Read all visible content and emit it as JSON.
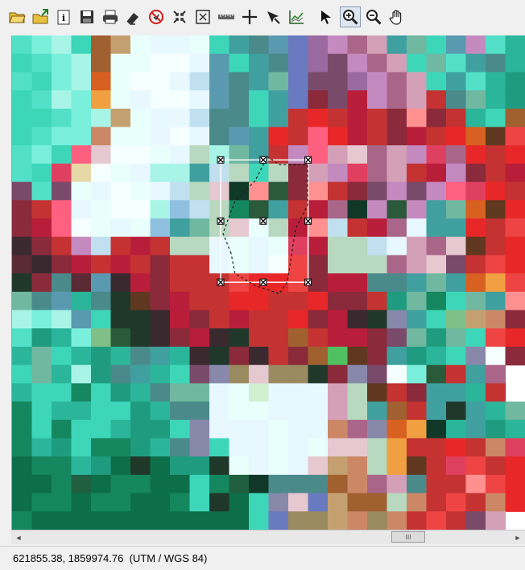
{
  "toolbar": {
    "buttons": [
      {
        "name": "open-folder-icon",
        "active": false
      },
      {
        "name": "export-icon",
        "active": false
      },
      {
        "name": "info-icon",
        "active": false
      },
      {
        "name": "save-icon",
        "active": false
      },
      {
        "name": "print-icon",
        "active": false
      },
      {
        "name": "eraser-icon",
        "active": false
      },
      {
        "name": "clear-selection-icon",
        "active": false
      },
      {
        "name": "shrink-icon",
        "active": false
      },
      {
        "name": "expand-icon",
        "active": false
      },
      {
        "name": "ruler-icon",
        "active": false
      },
      {
        "name": "crosshair-icon",
        "active": false
      },
      {
        "name": "edit-pointer-icon",
        "active": false
      },
      {
        "name": "chart-icon",
        "active": false
      },
      {
        "name": "select-arrow-icon",
        "active": false
      },
      {
        "name": "zoom-in-icon",
        "active": true
      },
      {
        "name": "zoom-out-icon",
        "active": false
      },
      {
        "name": "pan-hand-icon",
        "active": false
      }
    ]
  },
  "map": {
    "palette": {
      "a": "#3dd6b8",
      "b": "#52e0c8",
      "c": "#7af0dc",
      "d": "#a8f5e8",
      "e": "#e8fffb",
      "f": "#f5fffd",
      "g": "#2bb59a",
      "h": "#1f9c80",
      "i": "#15875f",
      "j": "#0d6e4a",
      "k": "#c43232",
      "l": "#e82828",
      "m": "#b81e3a",
      "n": "#8a2a3a",
      "o": "#5a2a35",
      "p": "#3a2a30",
      "q": "#7a4a6a",
      "r": "#9a6aa0",
      "s": "#c48ac0",
      "t": "#d4a0b8",
      "u": "#e6c8d0",
      "v": "#4a8a8a",
      "w": "#5a9ab0",
      "x": "#6a7ac0",
      "y": "#9a8a60",
      "z": "#c4a070",
      "A": "#e8d8a8",
      "B": "#f0a040",
      "C": "#d86020",
      "D": "#a06030",
      "E": "#603820",
      "F": "#20382a",
      "G": "#2a5a3a",
      "H": "#80c088",
      "I": "#b8d8c0",
      "J": "#50c060",
      "K": "#e04060",
      "L": "#ff6080",
      "M": "#ff9090",
      "N": "#c0e0f0",
      "O": "#90c0e0",
      "P": "#40a0a0",
      "Q": "#d0f0d0",
      "R": "#70b8a0",
      "S": "#206040",
      "T": "#103828",
      "U": "#e8f8ff",
      "V": "#8888aa",
      "W": "#aa6688",
      "X": "#cc8866",
      "Y": "#ee4444",
      "Z": "#44cc88"
    },
    "rows": [
      "bcdaDzeUUeaPvwxrsWtPRawsbg",
      "abcdDeeffUwaPvxrqsWtaRbPvg",
      "bacdCeffUNwvPRxqqrsWtaPbgh",
      "abdcBeUffUwvaPxnqmsWtkvRgh",
      "aabcdzeUUNvvaPklkmknMnkgaD",
      "abccXeeUfUvwPlkLlmknmklCEY",
      "bcaLuffeUIdRPksLtuWtsKWlkl",
      "baKAfeUddPNIaIntsKWtkmsnkm",
      "qbqeUfeUNIuTMGnMknqsqsLKlk",
      "nkLUeffdONIiGPkmWTsGsPRCEl",
      "nmLfeUeOPRIueImMNkmWUPPlkY",
      "pnksNkmkIIUeUeKmIINUtWuEkl",
      "opnmkmknkkUeUfYnIIIWtuqkYl",
      "FnvowpmnkkkYllYnmmvvPRPCBY",
      "RvwgvFEnmkkllkklnnkhRiaRPM",
      "dcdwaFFpmnkmkklnmpFVPaHzXn",
      "bhgcHGFpnmpFkkDkmmnqRhRaYl",
      "gRaghgvPgpFnpknDJEnPhgaVfn",
      "aRgdhvPgaqVyuyyFnVqfcGkPW",
      "gaaiahgvRRUeQUUUtIEknPPgk",
      "iaggaahgvvUeeUUUtIPDkPFPgR",
      "iaiaaghhaVUUUeUUXWVCBTgPhg",
      "ighaiihgvVaUUeUeuuIBkklkXK",
      "jiighjFjhhFeUeUuzXIBEkKYkl",
      "jjiSjiijjaiSTvvvDXWtvkkMYl",
      "jiijiijjiaFjaVuxzDDIXkYkXl",
      "ijjjjjjjjjjjaxyyzXyXkYkqt"
    ]
  },
  "selection": {
    "handles": [
      {
        "name": "handle-nw",
        "col": 4.65,
        "row": 3.05
      },
      {
        "name": "handle-n",
        "col": 5.6,
        "row": 3.05
      },
      {
        "name": "handle-ne",
        "col": 6.6,
        "row": 3.05
      },
      {
        "name": "handle-w",
        "col": 4.65,
        "row": 4.55
      },
      {
        "name": "handle-center",
        "col": 5.6,
        "row": 4.55
      },
      {
        "name": "handle-e",
        "col": 6.6,
        "row": 4.55
      },
      {
        "name": "handle-sw",
        "col": 4.65,
        "row": 6.05
      },
      {
        "name": "handle-s",
        "col": 5.6,
        "row": 6.05
      },
      {
        "name": "handle-se",
        "col": 6.6,
        "row": 6.05
      }
    ]
  },
  "scrollbar": {
    "left_arrow": "◄",
    "right_arrow": "►",
    "thumb_grip": "III"
  },
  "status": {
    "coordinates": "621855.38, 1859974.76  (UTM / WGS 84)"
  }
}
